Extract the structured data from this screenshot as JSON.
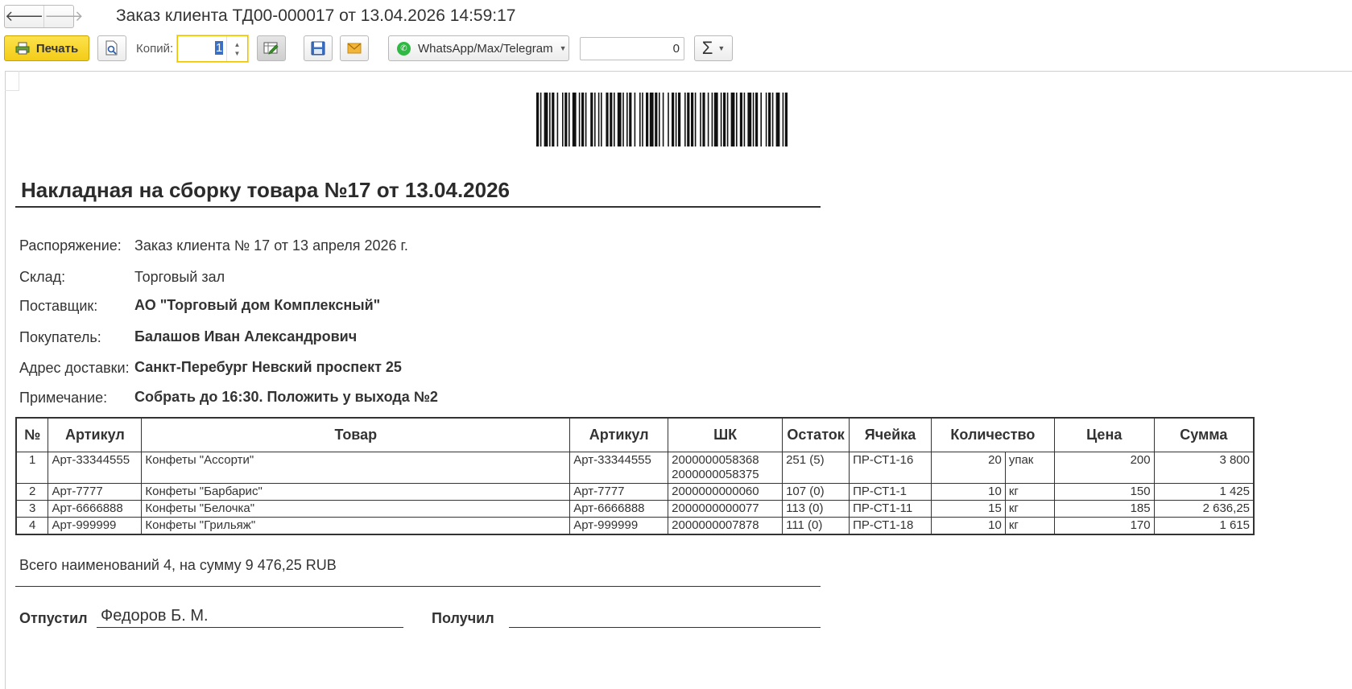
{
  "window": {
    "title": "Заказ клиента ТД00-000017 от 13.04.2026 14:59:17",
    "back_icon": "arrow-left-icon",
    "forward_icon": "arrow-right-icon"
  },
  "toolbar": {
    "print_label": "Печать",
    "copies_label": "Копий:",
    "copies_value": "1",
    "messenger_label": "WhatsApp/Max/Telegram",
    "sum_value": "0",
    "sigma_label": "Σ",
    "accent_color": "#f6d12a"
  },
  "document": {
    "title": "Накладная на сборку товара №17 от 13.04.2026",
    "fields": [
      {
        "label": "Распоряжение:",
        "value": "Заказ клиента № 17 от 13 апреля 2026 г.",
        "bold": false
      },
      {
        "label": "Склад:",
        "value": "Торговый зал",
        "bold": false
      },
      {
        "label": "Поставщик:",
        "value": "АО \"Торговый дом Комплексный\"",
        "bold": true
      },
      {
        "label": "Покупатель:",
        "value": "Балашов Иван Александрович",
        "bold": true
      },
      {
        "label": "Адрес доставки:",
        "value": "Санкт-Перебург Невский проспект 25",
        "bold": true
      },
      {
        "label": "Примечание:",
        "value": "Собрать до 16:30. Положить у выхода №2",
        "bold": true
      }
    ],
    "table": {
      "headers": [
        "№",
        "Артикул",
        "Товар",
        "Артикул",
        "ШК",
        "Остаток",
        "Ячейка",
        "Количество",
        "Цена",
        "Сумма"
      ],
      "rows": [
        {
          "n": "1",
          "art": "Арт-33344555",
          "name": "Конфеты \"Ассорти\"",
          "art2": "Арт-33344555",
          "barcode": "2000000058368",
          "barcode2": "2000000058375",
          "stock": "251 (5)",
          "cell": "ПР-СТ1-16",
          "qty": "20",
          "unit": "упак",
          "price": "200",
          "sum": "3 800"
        },
        {
          "n": "2",
          "art": "Арт-7777",
          "name": "Конфеты \"Барбарис\"",
          "art2": "Арт-7777",
          "barcode": "2000000000060",
          "barcode2": "",
          "stock": "107 (0)",
          "cell": "ПР-СТ1-1",
          "qty": "10",
          "unit": "кг",
          "price": "150",
          "sum": "1 425"
        },
        {
          "n": "3",
          "art": "Арт-6666888",
          "name": "Конфеты \"Белочка\"",
          "art2": "Арт-6666888",
          "barcode": "2000000000077",
          "barcode2": "",
          "stock": "113 (0)",
          "cell": "ПР-СТ1-11",
          "qty": "15",
          "unit": "кг",
          "price": "185",
          "sum": "2 636,25"
        },
        {
          "n": "4",
          "art": "Арт-999999",
          "name": "Конфеты \"Грильяж\"",
          "art2": "Арт-999999",
          "barcode": "2000000007878",
          "barcode2": "",
          "stock": "111 (0)",
          "cell": "ПР-СТ1-18",
          "qty": "10",
          "unit": "кг",
          "price": "170",
          "sum": "1 615"
        }
      ]
    },
    "summary": "Всего наименований 4, на сумму 9 476,25 RUB",
    "released_label": "Отпустил",
    "released_name": "Федоров Б. М.",
    "received_label": "Получил"
  }
}
